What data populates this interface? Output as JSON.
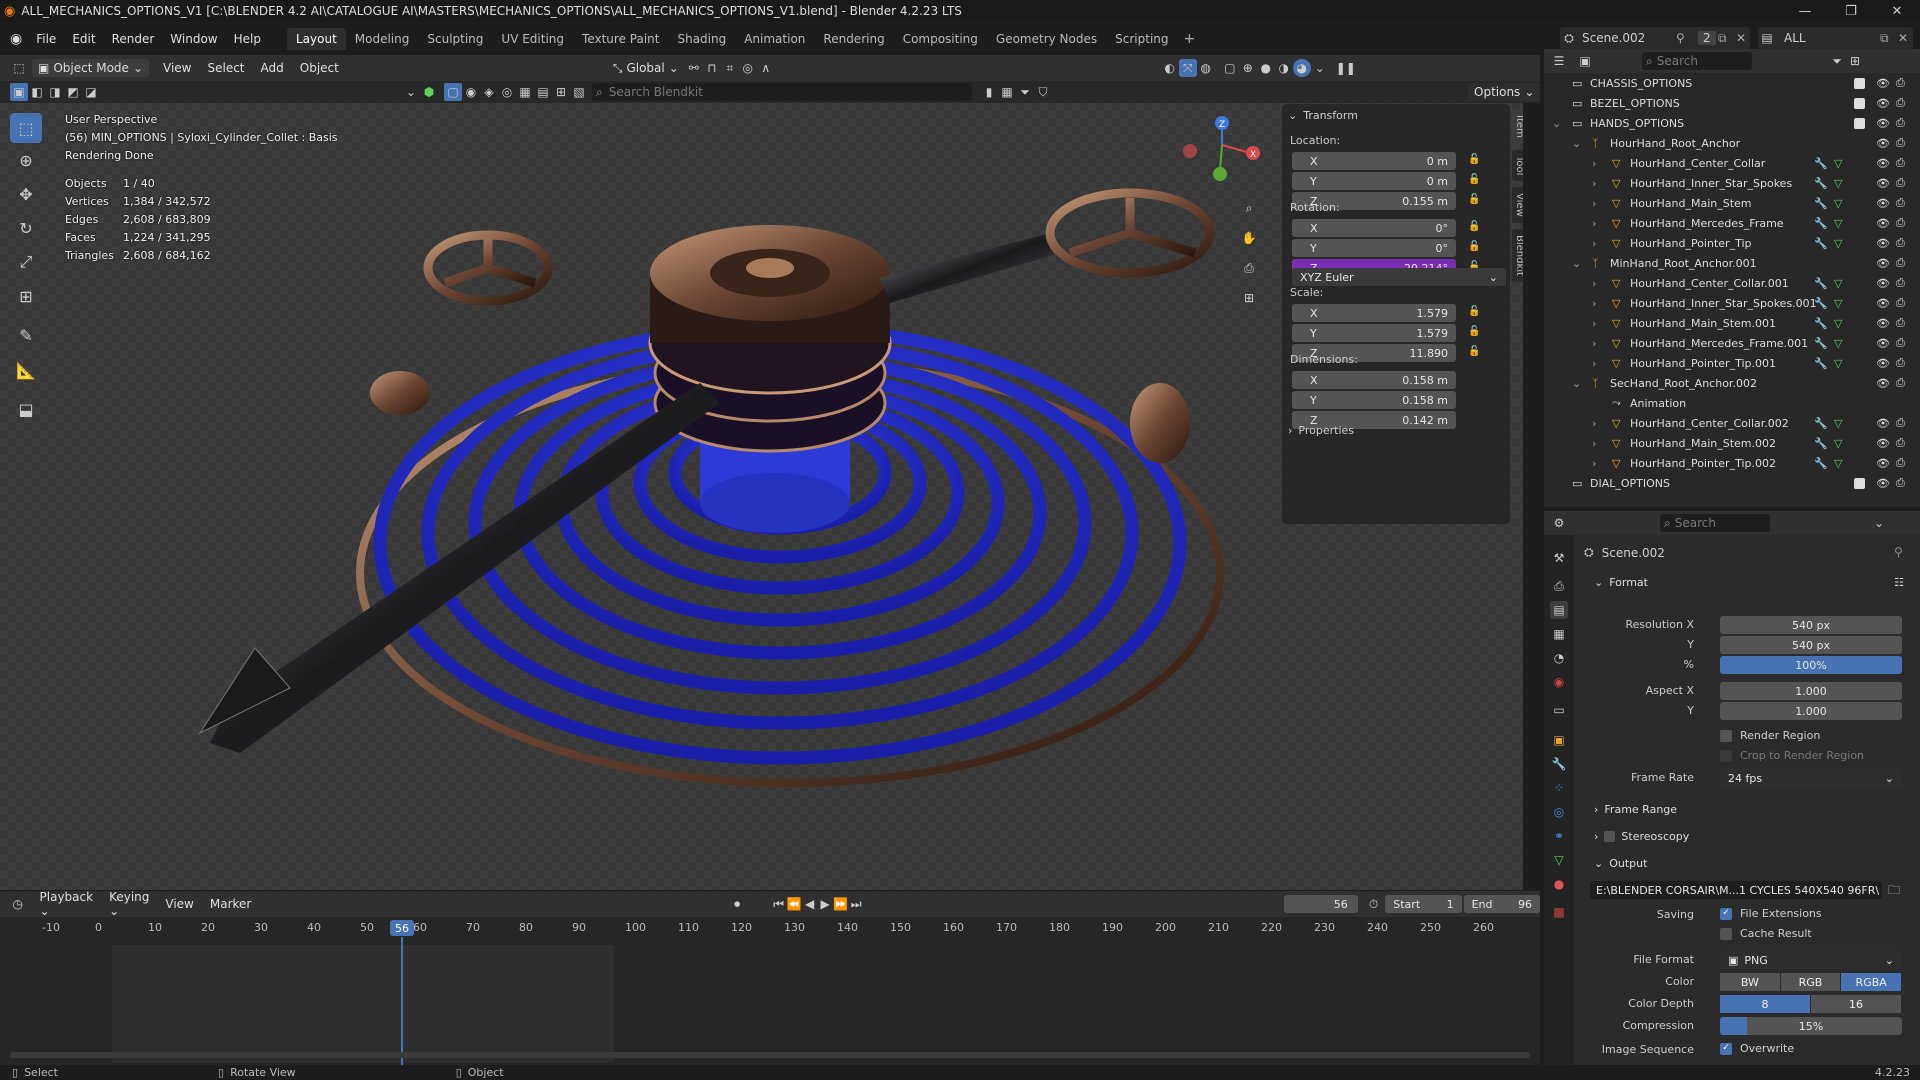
{
  "window": {
    "title": "ALL_MECHANICS_OPTIONS_V1 [C:\\BLENDER 4.2 AI\\CATALOGUE AI\\MASTERS\\MECHANICS_OPTIONS\\ALL_MECHANICS_OPTIONS_V1.blend] - Blender 4.2.23 LTS"
  },
  "menu": [
    "File",
    "Edit",
    "Render",
    "Window",
    "Help"
  ],
  "workspaces": [
    "Layout",
    "Modeling",
    "Sculpting",
    "UV Editing",
    "Texture Paint",
    "Shading",
    "Animation",
    "Rendering",
    "Compositing",
    "Geometry Nodes",
    "Scripting"
  ],
  "active_workspace": "Layout",
  "scene": {
    "name": "Scene.002",
    "users": "2",
    "view_layer": "ALL"
  },
  "vp_header": {
    "mode": "Object Mode",
    "menus": [
      "View",
      "Select",
      "Add",
      "Object"
    ],
    "orientation": "Global",
    "search_placeholder": "Search Blendkit",
    "options": "Options"
  },
  "overlay": {
    "perspective": "User Perspective",
    "object_line": "(56) MIN_OPTIONS | Syloxi_Cylinder_Collet : Basis",
    "render_status": "Rendering Done",
    "stats": [
      [
        "Objects",
        "1 / 40"
      ],
      [
        "Vertices",
        "1,384 / 342,572"
      ],
      [
        "Edges",
        "2,608 / 683,809"
      ],
      [
        "Faces",
        "1,224 / 341,295"
      ],
      [
        "Triangles",
        "2,608 / 684,162"
      ]
    ]
  },
  "npanel": {
    "title": "Transform",
    "location_label": "Location:",
    "rotation_label": "Rotation:",
    "scale_label": "Scale:",
    "dimensions_label": "Dimensions:",
    "location": [
      [
        "X",
        "0 m"
      ],
      [
        "Y",
        "0 m"
      ],
      [
        "Z",
        "0.155 m"
      ]
    ],
    "rotation": [
      [
        "X",
        "0°"
      ],
      [
        "Y",
        "0°"
      ],
      [
        "Z",
        "29.214°"
      ]
    ],
    "rotation_mode": "XYZ Euler",
    "scale": [
      [
        "X",
        "1.579"
      ],
      [
        "Y",
        "1.579"
      ],
      [
        "Z",
        "11.890"
      ]
    ],
    "dimensions": [
      [
        "X",
        "0.158 m"
      ],
      [
        "Y",
        "0.158 m"
      ],
      [
        "Z",
        "0.142 m"
      ]
    ],
    "properties": "Properties",
    "tabs": [
      "Item",
      "Tool",
      "View",
      "Blendkit"
    ]
  },
  "timeline": {
    "menus": [
      "Playback",
      "Keying",
      "View",
      "Marker"
    ],
    "current_frame": "56",
    "start_label": "Start",
    "start": "1",
    "end_label": "End",
    "end": "96",
    "ticks": [
      "-10",
      "0",
      "10",
      "20",
      "30",
      "40",
      "50",
      "60",
      "70",
      "80",
      "90",
      "100",
      "110",
      "120",
      "130",
      "140",
      "150",
      "160",
      "170",
      "180",
      "190",
      "200",
      "210",
      "220",
      "230",
      "240",
      "250",
      "260"
    ]
  },
  "outliner": {
    "search_placeholder": "Search",
    "rows": [
      {
        "name": "CHASSIS_OPTIONS",
        "indent": 0,
        "type": "collection"
      },
      {
        "name": "BEZEL_OPTIONS",
        "indent": 0,
        "type": "collection"
      },
      {
        "name": "HANDS_OPTIONS",
        "indent": 0,
        "type": "collection"
      },
      {
        "name": "HourHand_Root_Anchor",
        "indent": 1,
        "type": "armature"
      },
      {
        "name": "HourHand_Center_Collar",
        "indent": 2,
        "type": "mesh"
      },
      {
        "name": "HourHand_Inner_Star_Spokes",
        "indent": 2,
        "type": "mesh"
      },
      {
        "name": "HourHand_Main_Stem",
        "indent": 2,
        "type": "mesh"
      },
      {
        "name": "HourHand_Mercedes_Frame",
        "indent": 2,
        "type": "mesh"
      },
      {
        "name": "HourHand_Pointer_Tip",
        "indent": 2,
        "type": "mesh"
      },
      {
        "name": "MinHand_Root_Anchor.001",
        "indent": 1,
        "type": "armature"
      },
      {
        "name": "HourHand_Center_Collar.001",
        "indent": 2,
        "type": "mesh"
      },
      {
        "name": "HourHand_Inner_Star_Spokes.001",
        "indent": 2,
        "type": "mesh"
      },
      {
        "name": "HourHand_Main_Stem.001",
        "indent": 2,
        "type": "mesh"
      },
      {
        "name": "HourHand_Mercedes_Frame.001",
        "indent": 2,
        "type": "mesh"
      },
      {
        "name": "HourHand_Pointer_Tip.001",
        "indent": 2,
        "type": "mesh"
      },
      {
        "name": "SecHand_Root_Anchor.002",
        "indent": 1,
        "type": "armature"
      },
      {
        "name": "Animation",
        "indent": 2,
        "type": "anim"
      },
      {
        "name": "HourHand_Center_Collar.002",
        "indent": 2,
        "type": "mesh"
      },
      {
        "name": "HourHand_Main_Stem.002",
        "indent": 2,
        "type": "mesh"
      },
      {
        "name": "HourHand_Pointer_Tip.002",
        "indent": 2,
        "type": "mesh"
      },
      {
        "name": "DIAL_OPTIONS",
        "indent": 0,
        "type": "collection"
      }
    ]
  },
  "props": {
    "search_placeholder": "Search",
    "scene": "Scene.002",
    "format": "Format",
    "res_x_label": "Resolution X",
    "res_x": "540 px",
    "res_y_label": "Y",
    "res_y": "540 px",
    "pct_label": "%",
    "pct": "100%",
    "aspect_x_label": "Aspect X",
    "aspect_x": "1.000",
    "aspect_y_label": "Y",
    "aspect_y": "1.000",
    "render_region": "Render Region",
    "crop": "Crop to Render Region",
    "fps_label": "Frame Rate",
    "fps": "24 fps",
    "frame_range": "Frame Range",
    "stereoscopy": "Stereoscopy",
    "output": "Output",
    "path": "E:\\BLENDER CORSAIR\\M...1 CYCLES 540X540 96FR\\",
    "saving_label": "Saving",
    "file_ext": "File Extensions",
    "cache": "Cache Result",
    "format_label": "File Format",
    "file_format": "PNG",
    "color_label": "Color",
    "color_opts": [
      "BW",
      "RGB",
      "RGBA"
    ],
    "depth_label": "Color Depth",
    "depth_opts": [
      "8",
      "16"
    ],
    "compression_label": "Compression",
    "compression": "15%",
    "imgseq_label": "Image Sequence",
    "overwrite": "Overwrite"
  },
  "status": {
    "select": "Select",
    "rotate": "Rotate View",
    "object": "Object",
    "version": "4.2.23"
  },
  "colors": {
    "accent": "#4772b3",
    "purple": "#7a2db5",
    "blue_coil": "#2a35d8"
  }
}
